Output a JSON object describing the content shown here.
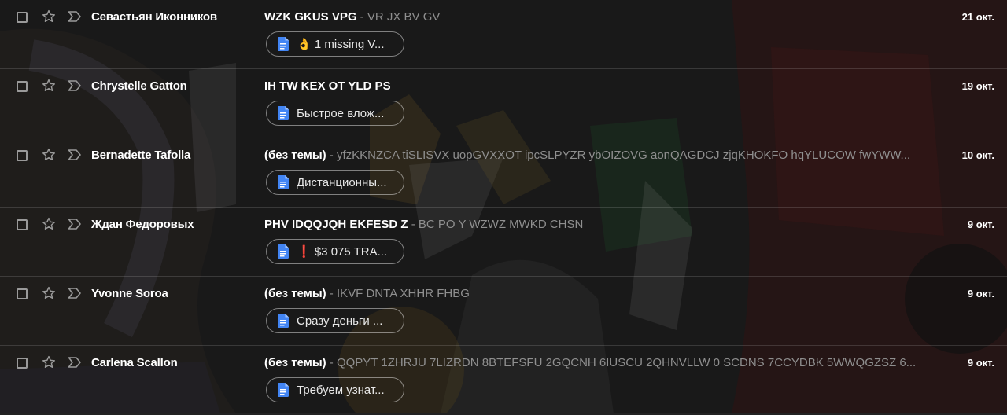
{
  "colors": {
    "text_primary": "#ffffff",
    "text_secondary": "#8f8f8f",
    "doc_icon": "#4285f4",
    "chip_border": "rgba(255,255,255,0.45)"
  },
  "emails": [
    {
      "sender": "Севастьян Иконников",
      "subject": "WZK GKUS VPG",
      "separator": " - ",
      "snippet": "VR JX BV GV",
      "date": "21 окт.",
      "attachment": {
        "icon": "google-docs-icon",
        "label": "👌 1 missing V..."
      }
    },
    {
      "sender": "Chrystelle Gatton",
      "subject": "IH TW KEX OT YLD PS",
      "separator": "",
      "snippet": "",
      "date": "19 окт.",
      "attachment": {
        "icon": "google-docs-icon",
        "label": "Быстрое влож..."
      }
    },
    {
      "sender": "Bernadette Tafolla",
      "subject": "(без темы)",
      "separator": " - ",
      "snippet": "yfzKKNZCA tiSLISVX uopGVXXOT ipcSLPYZR ybOIZOVG aonQAGDCJ zjqKHOKFO hqYLUCOW fwYWW...",
      "date": "10 окт.",
      "attachment": {
        "icon": "google-docs-icon",
        "label": "Дистанционны..."
      }
    },
    {
      "sender": "Ждан Федоровых",
      "subject": "PHV IDQQJQH EKFESD Z",
      "separator": " - ",
      "snippet": "BC PO Y WZWZ MWKD CHSN",
      "date": "9 окт.",
      "attachment": {
        "icon": "google-docs-icon",
        "label": "❗ $3 075 TRA..."
      }
    },
    {
      "sender": "Yvonne Soroa",
      "subject": "(без темы)",
      "separator": " - ",
      "snippet": "IKVF DNTA XHHR FHBG",
      "date": "9 окт.",
      "attachment": {
        "icon": "google-docs-icon",
        "label": "Сразу деньги ..."
      }
    },
    {
      "sender": "Carlena Scallon",
      "subject": "(без темы)",
      "separator": " - ",
      "snippet": "QQPYT 1ZHRJU 7LIZRDN 8BTEFSFU 2GQCNH 6IUSCU 2QHNVLLW 0 SCDNS 7CCYDBK 5WWQGZSZ 6...",
      "date": "9 окт.",
      "attachment": {
        "icon": "google-docs-icon",
        "label": "Требуем узнат..."
      }
    }
  ]
}
